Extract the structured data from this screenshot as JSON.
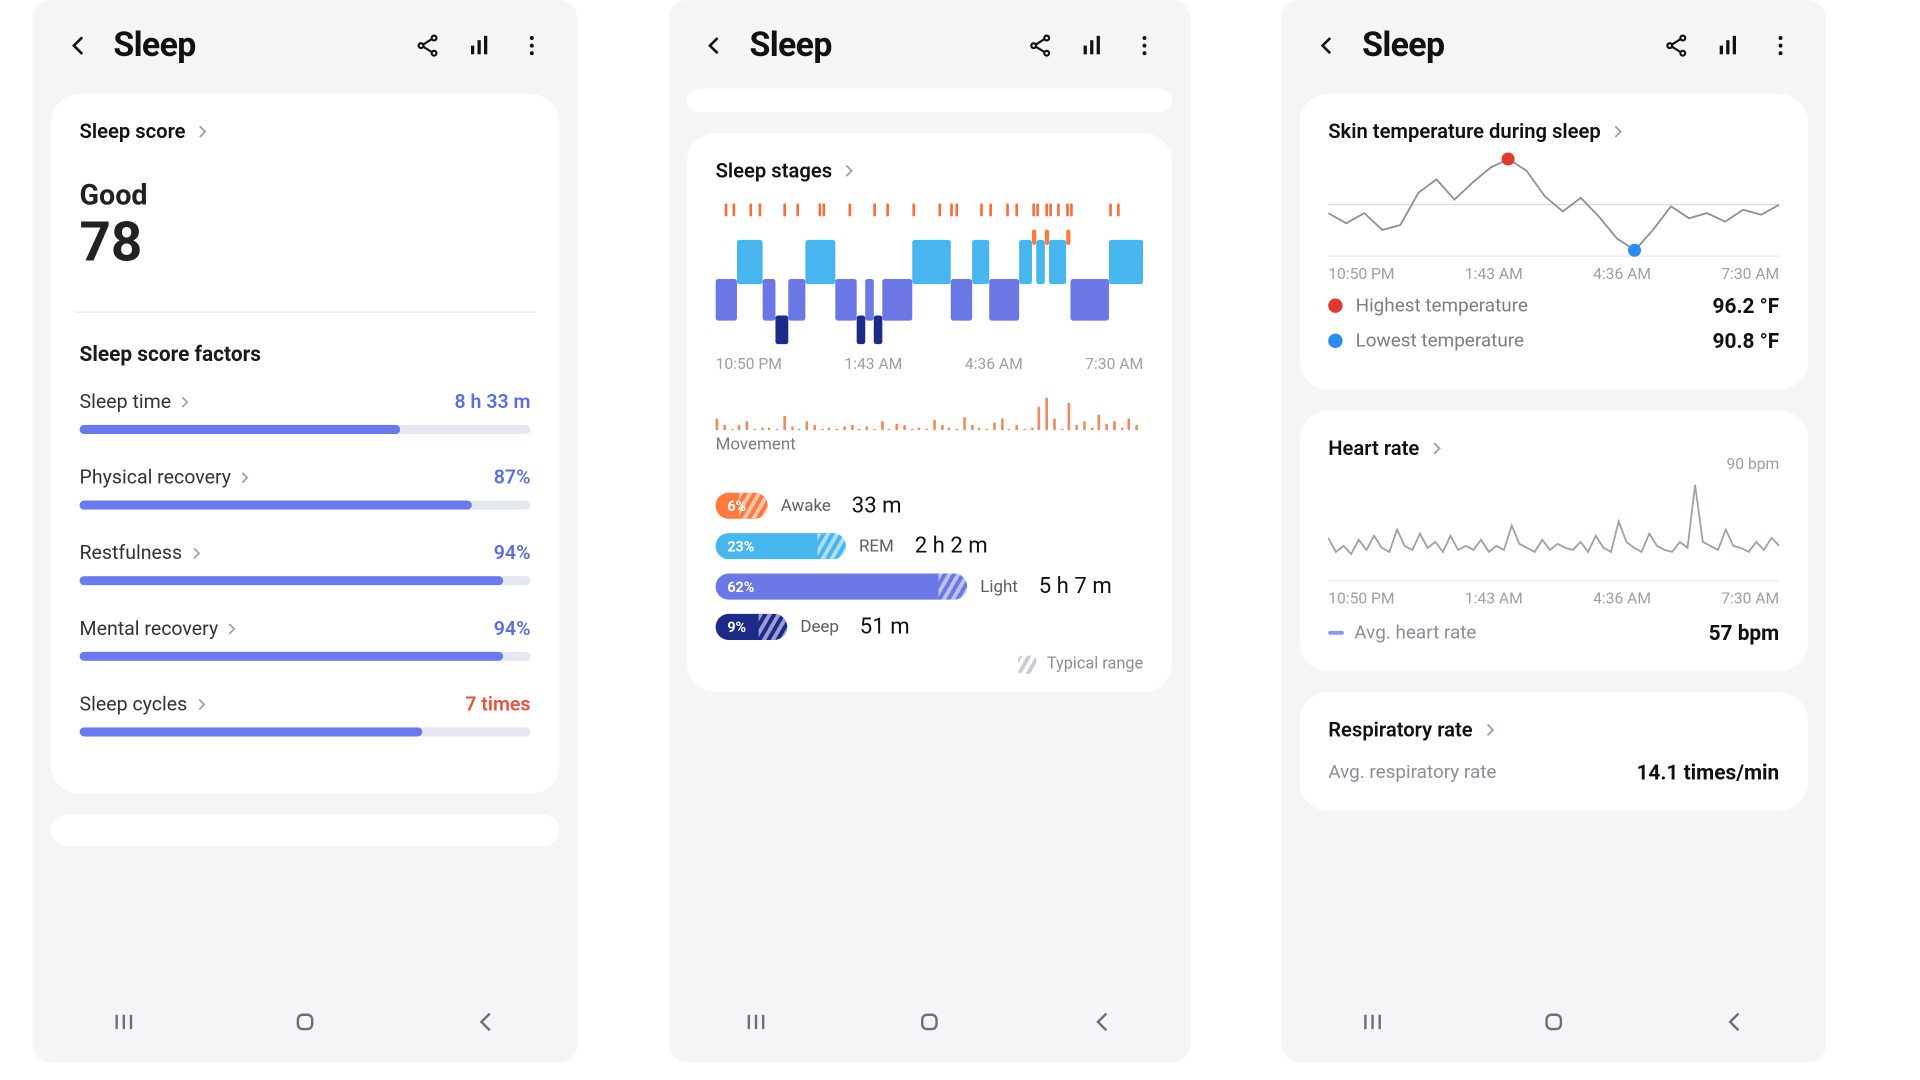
{
  "colors": {
    "accent": "#697af0",
    "awake": "#ff7a3d",
    "rem": "#47b6ef",
    "light": "#6a77e5",
    "deep": "#1c2a8a",
    "hot": "#e03a2f",
    "cold": "#2a8bf2"
  },
  "axis_labels": [
    "10:50 PM",
    "1:43 AM",
    "4:36 AM",
    "7:30 AM"
  ],
  "p1": {
    "title": "Sleep",
    "score_link": "Sleep score",
    "rating": "Good",
    "score": "78",
    "factors_title": "Sleep score factors",
    "factors": [
      {
        "name": "Sleep time",
        "value": "8 h 33 m",
        "pct": 71,
        "blue": true
      },
      {
        "name": "Physical recovery",
        "value": "87%",
        "pct": 87,
        "blue": true
      },
      {
        "name": "Restfulness",
        "value": "94%",
        "pct": 94,
        "blue": true
      },
      {
        "name": "Mental recovery",
        "value": "94%",
        "pct": 94,
        "blue": true
      },
      {
        "name": "Sleep cycles",
        "value": "7 times",
        "pct": 76,
        "blue": false
      }
    ]
  },
  "p2": {
    "title": "Sleep",
    "link": "Sleep stages",
    "movement_label": "Movement",
    "stages": [
      {
        "k": "Awake",
        "pct": 6,
        "val": "33 m",
        "color": "#ff7a3d",
        "bar": 40
      },
      {
        "k": "REM",
        "pct": 23,
        "val": "2 h 2 m",
        "color": "#47b6ef",
        "bar": 100
      },
      {
        "k": "Light",
        "pct": 62,
        "val": "5 h 7 m",
        "color": "#6a77e5",
        "bar": 193
      },
      {
        "k": "Deep",
        "pct": 9,
        "val": "51 m",
        "color": "#1c2a8a",
        "bar": 55
      }
    ],
    "legend": "Typical range"
  },
  "p3": {
    "title": "Sleep",
    "temp_link": "Skin temperature during sleep",
    "temp_hi_label": "Highest temperature",
    "temp_hi": "96.2 °F",
    "temp_lo_label": "Lowest temperature",
    "temp_lo": "90.8 °F",
    "hr_link": "Heart rate",
    "hr_max": "90 bpm",
    "hr_avg_label": "Avg. heart rate",
    "hr_avg": "57 bpm",
    "rr_link": "Respiratory rate",
    "rr_avg_label": "Avg. respiratory rate",
    "rr_avg": "14.1 times/min"
  },
  "chart_data": [
    {
      "type": "line",
      "title": "Sleep stages (hypnogram)",
      "x": "time",
      "xticks": [
        "10:50 PM",
        "1:43 AM",
        "4:36 AM",
        "7:30 AM"
      ],
      "y_levels": [
        "Awake",
        "REM",
        "Light",
        "Deep"
      ],
      "segments": [
        {
          "stage": "Light",
          "from": 0,
          "to": 5
        },
        {
          "stage": "REM",
          "from": 5,
          "to": 11
        },
        {
          "stage": "Light",
          "from": 11,
          "to": 14
        },
        {
          "stage": "Deep",
          "from": 14,
          "to": 17
        },
        {
          "stage": "Light",
          "from": 17,
          "to": 21
        },
        {
          "stage": "REM",
          "from": 21,
          "to": 28
        },
        {
          "stage": "Light",
          "from": 28,
          "to": 33
        },
        {
          "stage": "Deep",
          "from": 33,
          "to": 35
        },
        {
          "stage": "Light",
          "from": 35,
          "to": 37
        },
        {
          "stage": "Deep",
          "from": 37,
          "to": 39
        },
        {
          "stage": "Light",
          "from": 39,
          "to": 46
        },
        {
          "stage": "REM",
          "from": 46,
          "to": 55
        },
        {
          "stage": "Light",
          "from": 55,
          "to": 60
        },
        {
          "stage": "REM",
          "from": 60,
          "to": 64
        },
        {
          "stage": "Light",
          "from": 64,
          "to": 71
        },
        {
          "stage": "REM",
          "from": 71,
          "to": 74
        },
        {
          "stage": "Awake",
          "from": 74,
          "to": 75
        },
        {
          "stage": "REM",
          "from": 75,
          "to": 77
        },
        {
          "stage": "Awake",
          "from": 77,
          "to": 78
        },
        {
          "stage": "REM",
          "from": 78,
          "to": 82
        },
        {
          "stage": "Awake",
          "from": 82,
          "to": 83
        },
        {
          "stage": "Light",
          "from": 83,
          "to": 92
        },
        {
          "stage": "REM",
          "from": 92,
          "to": 100
        }
      ],
      "awake_ticks": [
        2,
        4,
        8,
        10,
        16,
        19,
        24,
        25,
        31,
        37,
        40,
        46,
        52,
        55,
        56,
        62,
        64,
        68,
        70,
        74,
        75,
        77,
        78,
        80,
        82,
        83,
        92,
        94
      ]
    },
    {
      "type": "bar",
      "title": "Movement",
      "xticks": [
        "10:50 PM",
        "7:30 AM"
      ],
      "ylim": [
        0,
        1
      ],
      "values_pct": [
        30,
        10,
        0,
        12,
        20,
        0,
        5,
        3,
        0,
        35,
        8,
        0,
        22,
        10,
        0,
        5,
        0,
        8,
        12,
        0,
        6,
        0,
        20,
        0,
        15,
        10,
        0,
        3,
        0,
        25,
        10,
        5,
        0,
        32,
        12,
        5,
        0,
        18,
        28,
        0,
        10,
        0,
        5,
        60,
        85,
        30,
        0,
        70,
        10,
        20,
        5,
        40,
        15,
        20,
        5,
        30,
        10
      ]
    },
    {
      "type": "line",
      "title": "Skin temperature during sleep",
      "xticks": [
        "10:50 PM",
        "1:43 AM",
        "4:36 AM",
        "7:30 AM"
      ],
      "ylim": [
        90.8,
        96.2
      ],
      "unit": "°F",
      "y": [
        93.0,
        92.4,
        93.0,
        92.0,
        92.3,
        94.2,
        95.0,
        93.8,
        94.8,
        95.7,
        96.2,
        95.5,
        94.0,
        93.1,
        93.9,
        92.8,
        91.5,
        90.8,
        92.0,
        93.4,
        92.7,
        93.0,
        92.5,
        93.2,
        92.9,
        93.5
      ]
    },
    {
      "type": "line",
      "title": "Heart rate",
      "xticks": [
        "10:50 PM",
        "1:43 AM",
        "4:36 AM",
        "7:30 AM"
      ],
      "ylim": [
        45,
        90
      ],
      "unit": "bpm",
      "y": [
        62,
        55,
        58,
        54,
        61,
        56,
        63,
        57,
        55,
        66,
        58,
        56,
        64,
        57,
        60,
        55,
        63,
        56,
        58,
        56,
        61,
        55,
        58,
        56,
        68,
        59,
        57,
        55,
        61,
        56,
        59,
        57,
        56,
        60,
        55,
        63,
        57,
        55,
        70,
        60,
        57,
        55,
        64,
        58,
        56,
        55,
        60,
        57,
        88,
        60,
        58,
        56,
        66,
        58,
        57,
        55,
        60,
        56,
        62,
        58
      ]
    }
  ]
}
